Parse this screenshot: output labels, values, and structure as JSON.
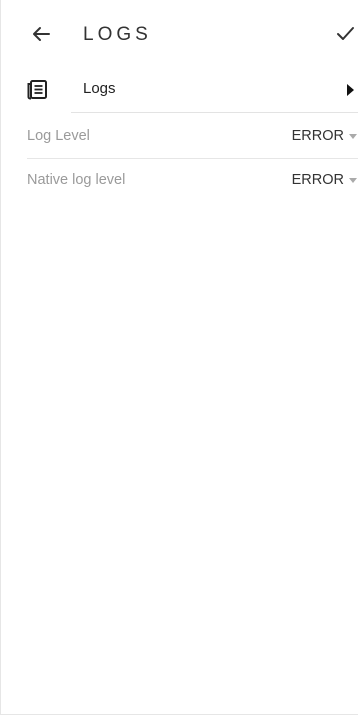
{
  "header": {
    "title": "LOGS",
    "back_icon": "arrow-left-icon",
    "confirm_icon": "checkmark-icon"
  },
  "logs_nav": {
    "label": "Logs",
    "icon": "document-list-icon",
    "arrow_icon": "triangle-right-icon"
  },
  "settings": [
    {
      "label": "Log Level",
      "value": "ERROR"
    },
    {
      "label": "Native log level",
      "value": "ERROR"
    }
  ],
  "colors": {
    "label_gray": "#9a9a9a",
    "text_dark": "#333333",
    "divider": "#e6e6e6"
  }
}
